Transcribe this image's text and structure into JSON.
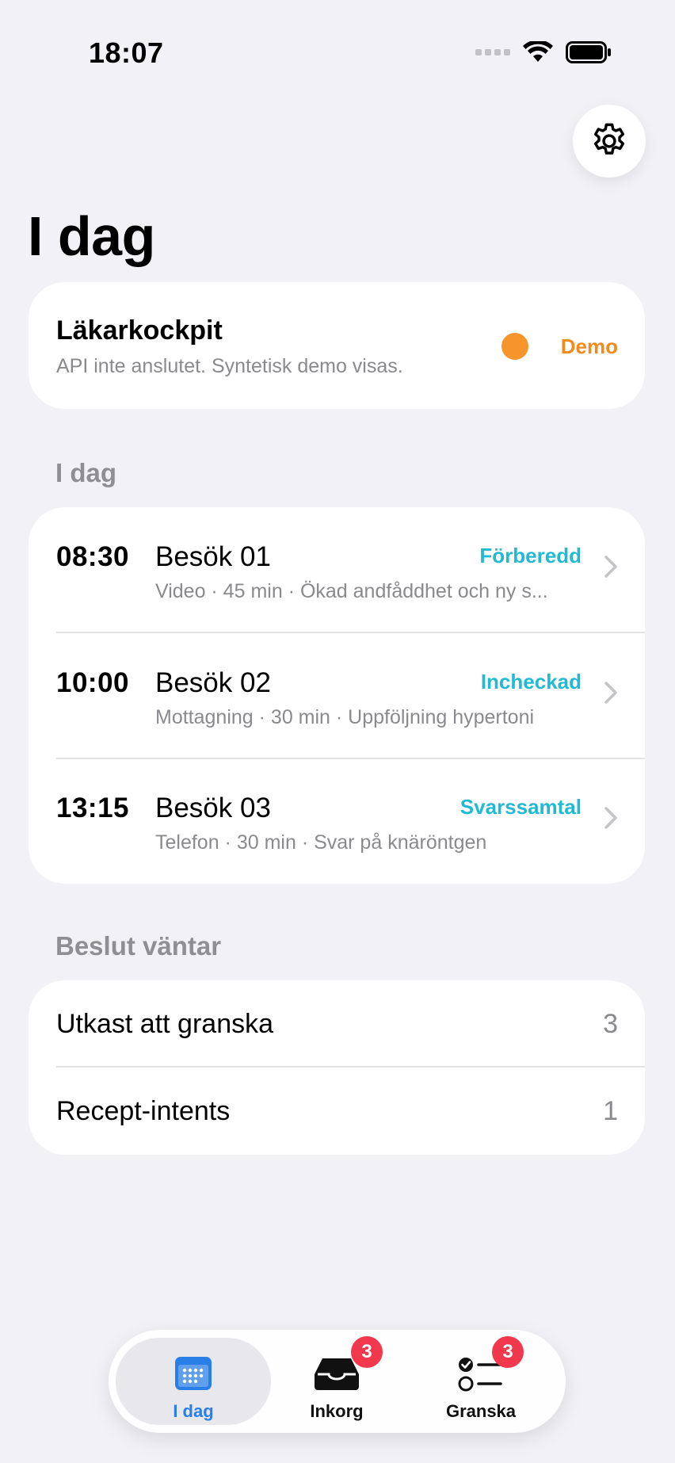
{
  "status_bar": {
    "time": "18:07"
  },
  "page": {
    "title": "I dag"
  },
  "cockpit": {
    "title": "Läkarkockpit",
    "subtitle": "API inte anslutet. Syntetisk demo visas.",
    "status_label": "Demo",
    "status_color": "#f7952d"
  },
  "today": {
    "heading": "I dag",
    "visits": [
      {
        "time": "08:30",
        "name": "Besök 01",
        "status": "Förberedd",
        "detail": "Video · 45 min · Ökad andfåddhet och ny s..."
      },
      {
        "time": "10:00",
        "name": "Besök 02",
        "status": "Incheckad",
        "detail": "Mottagning · 30 min · Uppföljning hypertoni"
      },
      {
        "time": "13:15",
        "name": "Besök 03",
        "status": "Svarssamtal",
        "detail": "Telefon · 30 min · Svar på knäröntgen"
      }
    ]
  },
  "decisions": {
    "heading": "Beslut väntar",
    "items": [
      {
        "label": "Utkast att granska",
        "count": "3"
      },
      {
        "label": "Recept-intents",
        "count": "1"
      }
    ]
  },
  "tabs": [
    {
      "label": "I dag",
      "icon": "calendar-icon",
      "active": true
    },
    {
      "label": "Inkorg",
      "icon": "inbox-tray-icon",
      "badge": "3"
    },
    {
      "label": "Granska",
      "icon": "checklist-icon",
      "badge": "3"
    }
  ],
  "colors": {
    "accent_blue": "#2a7fe6",
    "status_teal": "#22b9d2",
    "demo_orange": "#f28a1c",
    "badge_red": "#f2384d"
  }
}
